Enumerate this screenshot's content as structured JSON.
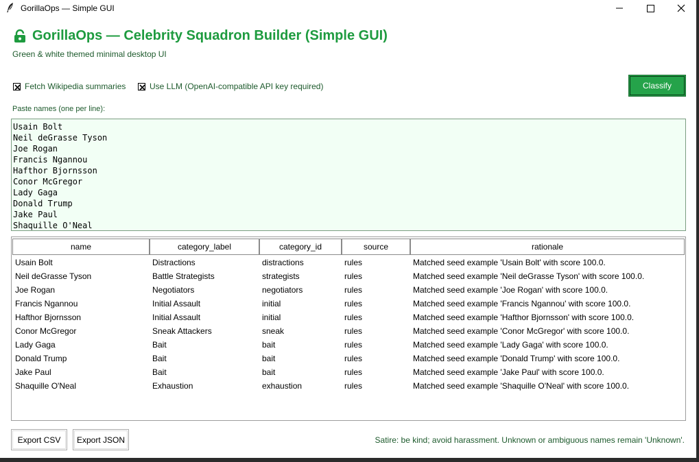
{
  "window": {
    "title": "GorillaOps — Simple GUI",
    "icon": "feather-icon",
    "controls": [
      "minimize-icon",
      "maximize-icon",
      "close-icon"
    ]
  },
  "header": {
    "icon": "lock-icon",
    "title": "GorillaOps — Celebrity Squadron Builder (Simple GUI)",
    "subtitle": "Green & white themed minimal desktop UI"
  },
  "options": {
    "fetch_wikipedia": {
      "label": "Fetch Wikipedia summaries",
      "checked": true
    },
    "use_llm": {
      "label": "Use LLM (OpenAI-compatible API key required)",
      "checked": true
    }
  },
  "classify_button": {
    "label": "Classify"
  },
  "names_input": {
    "label": "Paste names (one per line):",
    "lines": [
      "Usain Bolt",
      "Neil deGrasse Tyson",
      "Joe Rogan",
      "Francis Ngannou",
      "Hafthor Bjornsson",
      "Conor McGregor",
      "Lady Gaga",
      "Donald Trump",
      "Jake Paul",
      "Shaquille O'Neal"
    ]
  },
  "table": {
    "columns": [
      "name",
      "category_label",
      "category_id",
      "source",
      "rationale"
    ],
    "rows": [
      [
        "Usain Bolt",
        "Distractions",
        "distractions",
        "rules",
        "Matched seed example 'Usain Bolt' with score 100.0."
      ],
      [
        "Neil deGrasse Tyson",
        "Battle Strategists",
        "strategists",
        "rules",
        "Matched seed example 'Neil deGrasse Tyson' with score 100.0."
      ],
      [
        "Joe Rogan",
        "Negotiators",
        "negotiators",
        "rules",
        "Matched seed example 'Joe Rogan' with score 100.0."
      ],
      [
        "Francis Ngannou",
        "Initial Assault",
        "initial",
        "rules",
        "Matched seed example 'Francis Ngannou' with score 100.0."
      ],
      [
        "Hafthor Bjornsson",
        "Initial Assault",
        "initial",
        "rules",
        "Matched seed example 'Hafthor Bjornsson' with score 100.0."
      ],
      [
        "Conor McGregor",
        "Sneak Attackers",
        "sneak",
        "rules",
        "Matched seed example 'Conor McGregor' with score 100.0."
      ],
      [
        "Lady Gaga",
        "Bait",
        "bait",
        "rules",
        "Matched seed example 'Lady Gaga' with score 100.0."
      ],
      [
        "Donald Trump",
        "Bait",
        "bait",
        "rules",
        "Matched seed example 'Donald Trump' with score 100.0."
      ],
      [
        "Jake Paul",
        "Bait",
        "bait",
        "rules",
        "Matched seed example 'Jake Paul' with score 100.0."
      ],
      [
        "Shaquille O'Neal",
        "Exhaustion",
        "exhaustion",
        "rules",
        "Matched seed example 'Shaquille O'Neal' with score 100.0."
      ]
    ]
  },
  "footer": {
    "export_csv": "Export CSV",
    "export_json": "Export JSON",
    "note": "Satire: be kind; avoid harassment. Unknown or ambiguous names remain 'Unknown'."
  },
  "colors": {
    "accent": "#1e9b3f",
    "button_green": "#25a34a",
    "text_green": "#1d5a2c",
    "input_bg": "#f2fff5"
  }
}
